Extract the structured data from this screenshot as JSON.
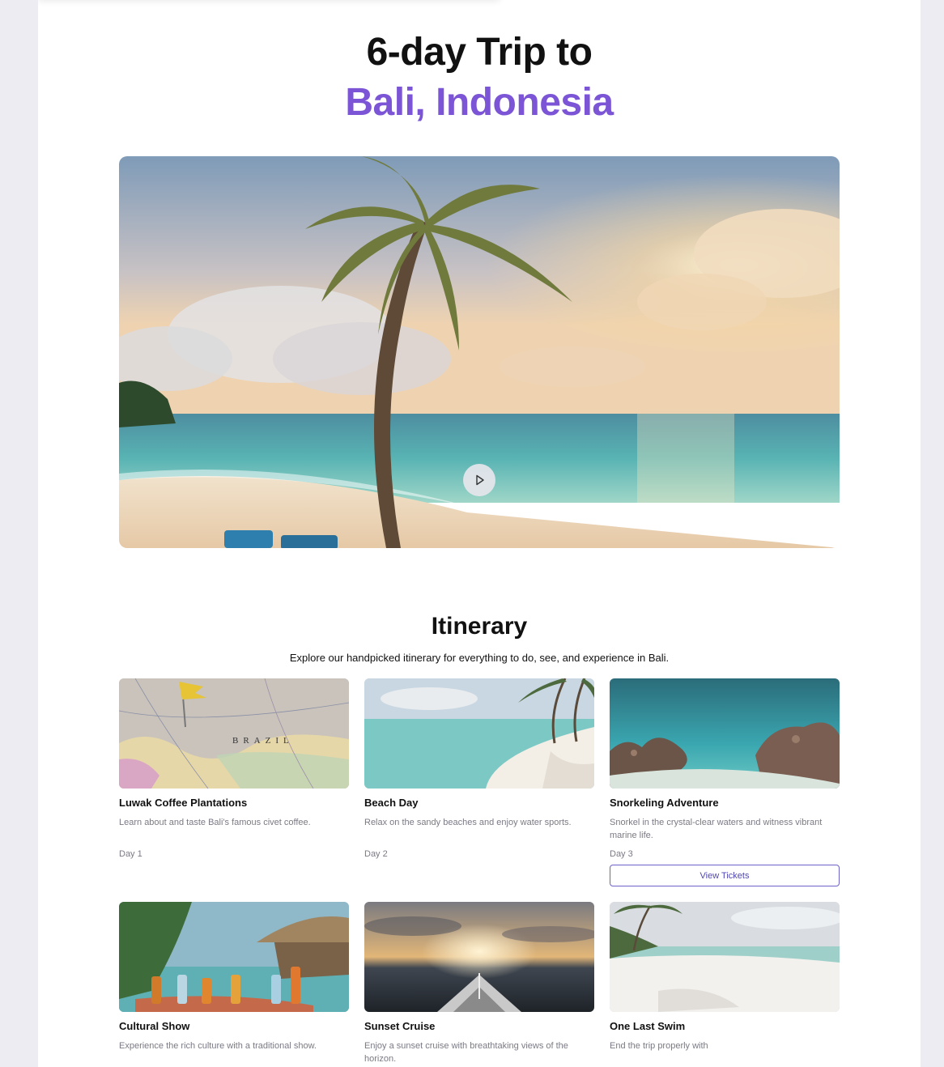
{
  "header": {
    "title_line1": "6-day Trip to",
    "title_line2": "Bali, Indonesia",
    "accent_color": "#7b55d6"
  },
  "hero": {
    "play_icon": "play-icon"
  },
  "itinerary": {
    "title": "Itinerary",
    "subtitle": "Explore our handpicked itinerary for everything to do, see, and experience in Bali.",
    "items": [
      {
        "name": "Luwak Coffee Plantations",
        "description": "Learn about and taste Bali's famous civet coffee.",
        "day": "Day 1"
      },
      {
        "name": "Beach Day",
        "description": "Relax on the sandy beaches and enjoy water sports.",
        "day": "Day 2"
      },
      {
        "name": "Snorkeling Adventure",
        "description": "Snorkel in the crystal-clear waters and witness vibrant marine life.",
        "day": "Day 3",
        "button": "View Tickets"
      },
      {
        "name": "Cultural Show",
        "description": "Experience the rich culture with a traditional show."
      },
      {
        "name": "Sunset Cruise",
        "description": "Enjoy a sunset cruise with breathtaking views of the horizon."
      },
      {
        "name": "One Last Swim",
        "description": "End the trip properly with"
      }
    ]
  }
}
